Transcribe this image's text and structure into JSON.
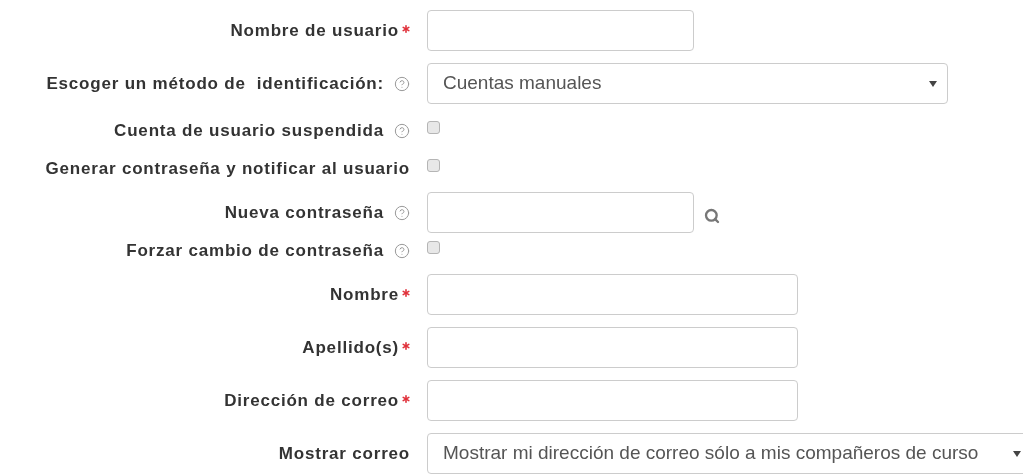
{
  "fields": [
    {
      "kind": "text",
      "label": "Nombre de usuario",
      "required": true,
      "help": false
    },
    {
      "kind": "select",
      "label": "Escoger un método de  identificación:",
      "required": false,
      "help": true,
      "value": "Cuentas manuales"
    },
    {
      "kind": "checkbox",
      "label": "Cuenta de usuario suspendida",
      "required": false,
      "help": true,
      "checked": false
    },
    {
      "kind": "checkbox",
      "label": "Generar contraseña y notificar al usuario",
      "required": false,
      "help": false,
      "checked": false
    },
    {
      "kind": "password",
      "label": "Nueva contraseña",
      "required": false,
      "help": true
    },
    {
      "kind": "checkbox",
      "label": "Forzar cambio de contraseña",
      "required": false,
      "help": true,
      "checked": false
    },
    {
      "kind": "text",
      "label": "Nombre",
      "required": true,
      "help": false
    },
    {
      "kind": "text",
      "label": "Apellido(s)",
      "required": true,
      "help": false
    },
    {
      "kind": "text",
      "label": "Dirección de correo",
      "required": true,
      "help": false
    },
    {
      "kind": "select",
      "label": "Mostrar correo",
      "required": false,
      "help": false,
      "value": "Mostrar mi dirección de correo sólo a mis compañeros de curso"
    }
  ]
}
